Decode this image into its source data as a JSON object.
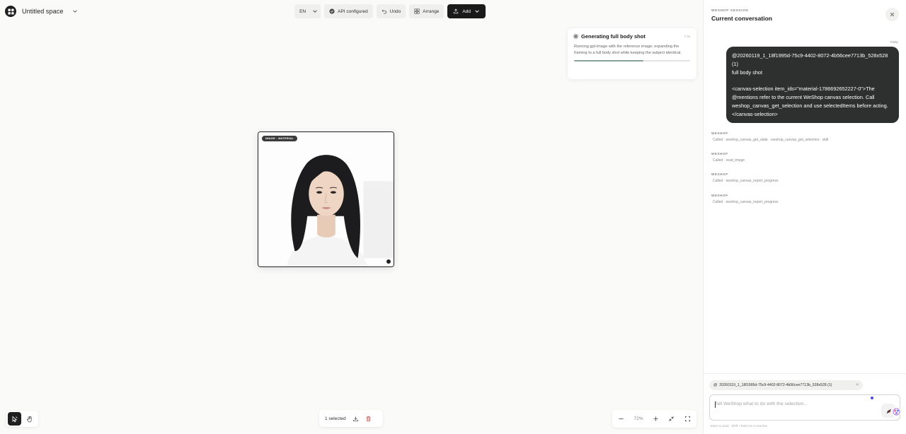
{
  "header": {
    "space_title": "Untitled space",
    "lang": "EN",
    "api_status": "API configured",
    "undo_label": "Undo",
    "arrange_label": "Arrange",
    "add_label": "Add"
  },
  "generation": {
    "title": "Generating full body shot",
    "time": "7.4s",
    "description": "Running gpt-image with the reference image; expanding the framing to a full body shot while keeping the subject identical.",
    "progress": 0.6
  },
  "canvas": {
    "image_tag": "IMAGE · MATERIAL",
    "selection_text": "1 selected",
    "zoom": "72%"
  },
  "panel": {
    "eyebrow": "WESHOP SESSION",
    "title": "Current conversation",
    "you_label": "YOU",
    "user_message_line1": "@20260119_1_18f1995d-75c9-4402-8072-4b56cee7713b_528x528 (1)",
    "user_message_line2": "full body shot",
    "user_message_line3": "<canvas-selection item_ids=\"material-1786692652227-0\">The @mentions refer to the current WeShop canvas selection. Call weshop_canvas_get_selection and use selectedItems before acting.</canvas-selection>",
    "tool_calls": [
      {
        "who": "WESHOP",
        "call": "Called · weshop_canvas_get_state · weshop_canvas_get_selection · skill"
      },
      {
        "who": "WESHOP",
        "call": "Called · read_image"
      },
      {
        "who": "WESHOP",
        "call": "Called · weshop_canvas_report_progress"
      },
      {
        "who": "WESHOP",
        "call": "Called · weshop_canvas_report_progress"
      }
    ],
    "mention_chip": "20260119_1_18f1995d-75c9-4402-8072-4b56cee7713b_528x528 (1)",
    "composer_placeholder": "Tell WeShop what to do with the selection...",
    "hint": "Enter to send · Shift + Enter for a new line"
  }
}
